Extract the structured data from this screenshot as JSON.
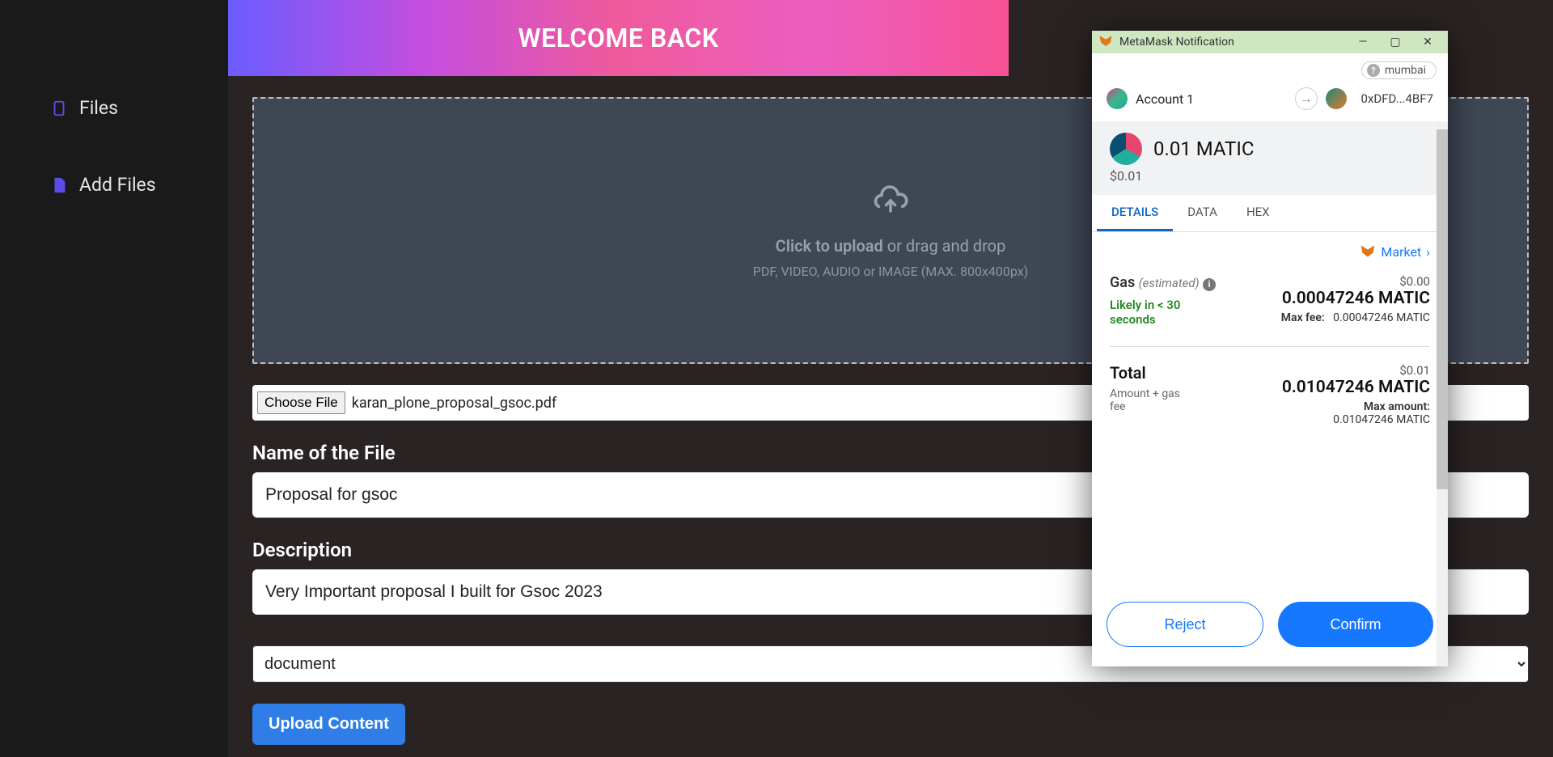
{
  "sidebar": {
    "items": [
      {
        "label": "Files"
      },
      {
        "label": "Add Files"
      }
    ]
  },
  "banner": {
    "title": "WELCOME BACK"
  },
  "dropzone": {
    "bold": "Click to upload",
    "rest": " or drag and drop",
    "hint": "PDF, VIDEO, AUDIO or IMAGE (MAX. 800x400px)"
  },
  "file": {
    "choose_label": "Choose File",
    "chosen": "karan_plone_proposal_gsoc.pdf"
  },
  "form": {
    "name_label": "Name of the File",
    "name_value": "Proposal for gsoc",
    "desc_label": "Description",
    "desc_value": "Very Important proposal I built for Gsoc 2023",
    "type_value": "document",
    "upload_label": "Upload Content"
  },
  "metamask": {
    "title": "MetaMask Notification",
    "network": "mumbai",
    "account": "Account 1",
    "to_address": "0xDFD...4BF7",
    "amount": "0.01 MATIC",
    "fiat": "$0.01",
    "tabs": {
      "details": "DETAILS",
      "data": "DATA",
      "hex": "HEX"
    },
    "market": "Market",
    "gas": {
      "label": "Gas",
      "est": "(estimated)",
      "fiat": "$0.00",
      "value": "0.00047246 MATIC",
      "likely": "Likely in < 30 seconds",
      "max_fee_label": "Max fee:",
      "max_fee": "0.00047246 MATIC"
    },
    "total": {
      "label": "Total",
      "fiat": "$0.01",
      "value": "0.01047246 MATIC",
      "sub": "Amount + gas fee",
      "max_amount_label": "Max amount:",
      "max_amount": "0.01047246 MATIC"
    },
    "reject": "Reject",
    "confirm": "Confirm"
  }
}
